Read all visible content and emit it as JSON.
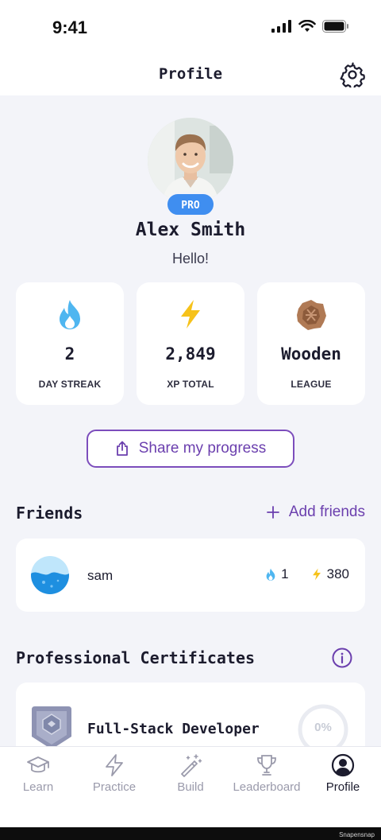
{
  "status_bar": {
    "time": "9:41"
  },
  "header": {
    "title": "Profile",
    "settings_icon": "gear-icon"
  },
  "profile": {
    "name": "Alex Smith",
    "greeting": "Hello!",
    "badge": "PRO"
  },
  "stats": [
    {
      "icon": "flame-icon",
      "value": "2",
      "label": "DAY STREAK",
      "color": "#4fb6f0"
    },
    {
      "icon": "lightning-icon",
      "value": "2,849",
      "label": "XP TOTAL",
      "color": "#f6c21a"
    },
    {
      "icon": "wooden-league-icon",
      "value": "Wooden",
      "label": "LEAGUE",
      "color": "#b07a55"
    }
  ],
  "share": {
    "label": "Share my progress",
    "icon": "share-icon"
  },
  "friends": {
    "title": "Friends",
    "add_label": "Add friends",
    "items": [
      {
        "name": "sam",
        "streak": "1",
        "xp": "380"
      }
    ]
  },
  "certificates": {
    "title": "Professional Certificates",
    "items": [
      {
        "name": "Full-Stack Developer",
        "progress": "0%"
      }
    ]
  },
  "tabs": [
    {
      "label": "Learn",
      "icon": "graduation-cap-icon",
      "active": false
    },
    {
      "label": "Practice",
      "icon": "lightning-icon",
      "active": false
    },
    {
      "label": "Build",
      "icon": "magic-wand-icon",
      "active": false
    },
    {
      "label": "Leaderboard",
      "icon": "trophy-icon",
      "active": false
    },
    {
      "label": "Profile",
      "icon": "user-circle-icon",
      "active": true
    }
  ],
  "watermark": "Snapensnap",
  "colors": {
    "accent": "#6b3fae",
    "pro_badge": "#3f8ef0",
    "background": "#f3f4f9"
  }
}
